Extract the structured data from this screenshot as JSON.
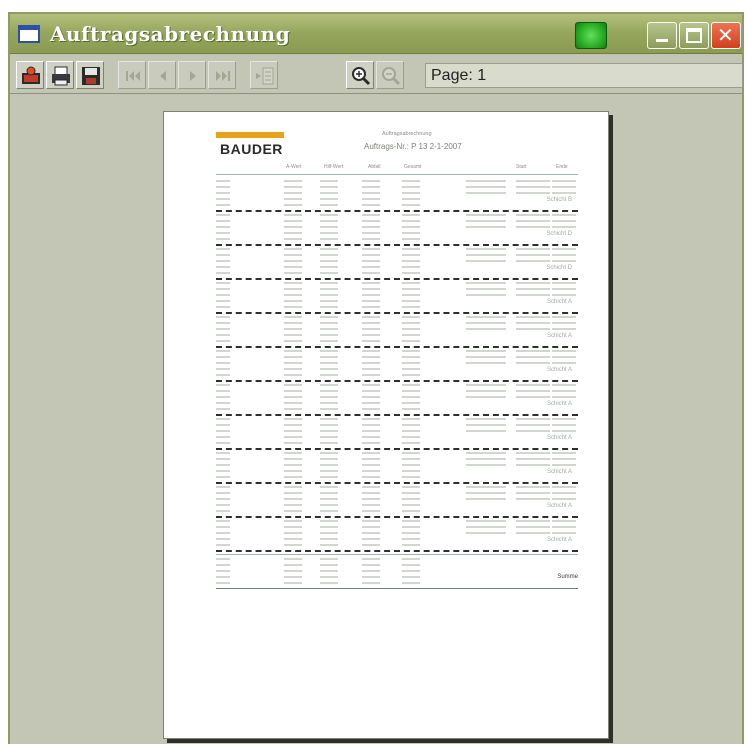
{
  "window": {
    "title": "Auftragsabrechnung",
    "icon": "window-icon",
    "status_color": "#2fbf28"
  },
  "toolbar": {
    "buttons": [
      {
        "name": "open-icon",
        "enabled": true
      },
      {
        "name": "print-icon",
        "enabled": true
      },
      {
        "name": "save-icon",
        "enabled": true
      },
      {
        "name": "first-page-icon",
        "enabled": false
      },
      {
        "name": "previous-page-icon",
        "enabled": false
      },
      {
        "name": "next-page-icon",
        "enabled": false
      },
      {
        "name": "last-page-icon",
        "enabled": false
      },
      {
        "name": "page-setup-icon",
        "enabled": false
      },
      {
        "name": "zoom-in-icon",
        "enabled": true
      },
      {
        "name": "zoom-out-icon",
        "enabled": false
      }
    ],
    "page_label": "Page: 1"
  },
  "report": {
    "logo_text": "BAUDER",
    "title": "Auftragsabrechnung",
    "order_line": "Auftrags-Nr.: P 13 2-1-2007",
    "columns": [
      "A-Wert",
      "Hilf-Wert",
      "Abfall",
      "Gesamt",
      "Start",
      "Ende"
    ],
    "shifts": [
      "Schicht B",
      "Schicht D",
      "Schicht D",
      "Schicht A",
      "Schicht A",
      "Schicht A",
      "Schicht A",
      "Schicht A",
      "Schicht A",
      "Schicht A",
      "Schicht A"
    ],
    "summary_label": "Summe",
    "colors": {
      "logo_orange": "#e8a21a",
      "rule": "#9fb5b5"
    }
  }
}
